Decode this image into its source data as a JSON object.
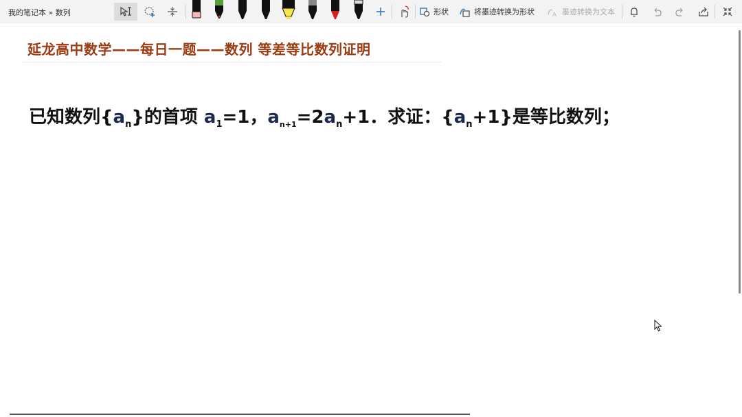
{
  "breadcrumb": "我的笔记本 » 数列",
  "toolbar": {
    "shapes_label": "形状",
    "ink_to_shape_label": "将墨迹转换为形状",
    "ink_to_text_label": "墨迹转换为文本"
  },
  "pens": [
    {
      "name": "pen-black",
      "color": "#111111",
      "tip": "#f4b9b9"
    },
    {
      "name": "pen-rainbow",
      "color": "#111111",
      "tip": "#e06c3c"
    },
    {
      "name": "pen-black-2",
      "color": "#111111",
      "tip": "#111111"
    },
    {
      "name": "pen-black-3",
      "color": "#111111",
      "tip": "#111111"
    },
    {
      "name": "highlighter-yellow",
      "color": "#f7e44a",
      "tip": "#f7e44a"
    },
    {
      "name": "pen-gray",
      "color": "#222222",
      "tip": "#7d7d7d"
    },
    {
      "name": "pen-red",
      "color": "#111111",
      "tip": "#d62020"
    },
    {
      "name": "pen-pattern",
      "color": "#111111",
      "tip": "#444444"
    }
  ],
  "note": {
    "title": "延龙高中数学——每日一题——数列 等差等比数列证明",
    "problem_prefix": "已知数列{",
    "a1": "a",
    "sub_n1": "n",
    "after_set1": "}的首项 ",
    "a2": "a",
    "sub_1": "1",
    "eq1": "=1，",
    "a3": "a",
    "sub_n_plus_1": "n+1",
    "eq2": "=2",
    "a4": "a",
    "sub_n2": "n",
    "eq3": "+1．求证：{",
    "a5": "a",
    "sub_n3": "n",
    "suffix": "+1}是等比数列；"
  },
  "colors": {
    "title": "#9a3b12",
    "toolbar_bg": "#f3f3f3"
  }
}
